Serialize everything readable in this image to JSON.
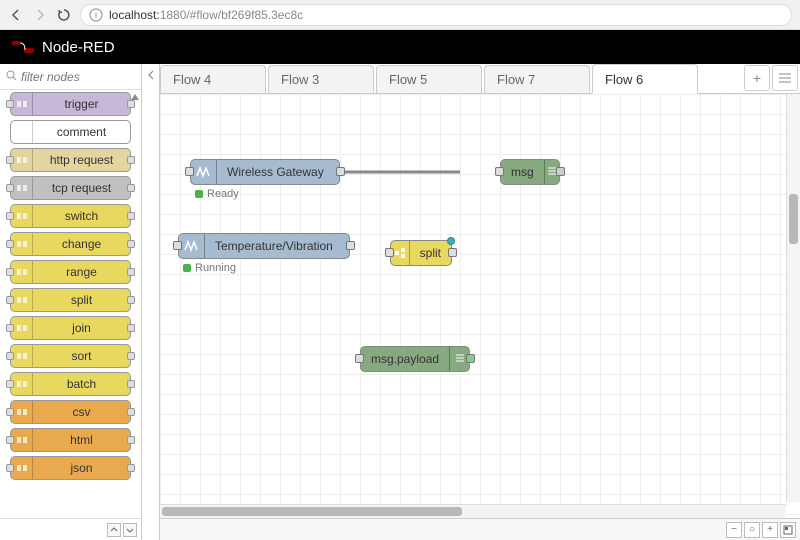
{
  "browser": {
    "host": "localhost:",
    "port": "1880",
    "path": "/#flow/bf269f85.3ec8c"
  },
  "header": {
    "title": "Node-RED"
  },
  "palette": {
    "search_placeholder": "filter nodes",
    "nodes": [
      {
        "label": "trigger",
        "color": "c-purple",
        "in": true,
        "out": true
      },
      {
        "label": "comment",
        "color": "c-white",
        "in": false,
        "out": false
      },
      {
        "label": "http request",
        "color": "c-tan",
        "in": true,
        "out": true
      },
      {
        "label": "tcp request",
        "color": "c-grey",
        "in": true,
        "out": true
      },
      {
        "label": "switch",
        "color": "c-yellow",
        "in": true,
        "out": true
      },
      {
        "label": "change",
        "color": "c-yellow",
        "in": true,
        "out": true
      },
      {
        "label": "range",
        "color": "c-yellow",
        "in": true,
        "out": true
      },
      {
        "label": "split",
        "color": "c-yellow",
        "in": true,
        "out": true
      },
      {
        "label": "join",
        "color": "c-yellow",
        "in": true,
        "out": true
      },
      {
        "label": "sort",
        "color": "c-yellow",
        "in": true,
        "out": true
      },
      {
        "label": "batch",
        "color": "c-yellow",
        "in": true,
        "out": true
      },
      {
        "label": "csv",
        "color": "c-orange",
        "in": true,
        "out": true
      },
      {
        "label": "html",
        "color": "c-orange",
        "in": true,
        "out": true
      },
      {
        "label": "json",
        "color": "c-orange",
        "in": true,
        "out": true
      }
    ]
  },
  "tabs": [
    {
      "label": "Flow 4",
      "active": false
    },
    {
      "label": "Flow 3",
      "active": false
    },
    {
      "label": "Flow 5",
      "active": false
    },
    {
      "label": "Flow 7",
      "active": false
    },
    {
      "label": "Flow 6",
      "active": true
    }
  ],
  "flow_nodes": {
    "gateway": {
      "label": "Wireless Gateway",
      "status_text": "Ready",
      "status_color": "#4caf50"
    },
    "msg1": {
      "label": "msg"
    },
    "tempvib": {
      "label": "Temperature/Vibration",
      "status_text": "Running",
      "status_color": "#4caf50"
    },
    "split": {
      "label": "split"
    },
    "msg2": {
      "label": "msg.payload"
    }
  }
}
